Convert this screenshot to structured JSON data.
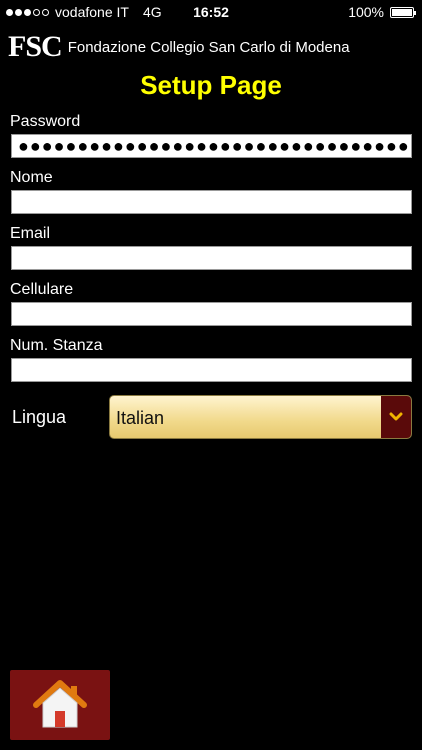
{
  "status_bar": {
    "carrier": "vodafone IT",
    "network": "4G",
    "time": "16:52",
    "battery_percent": "100%"
  },
  "header": {
    "logo": "FSC",
    "org_name": "Fondazione Collegio San Carlo di Modena",
    "title": "Setup Page"
  },
  "form": {
    "password": {
      "label": "Password",
      "value_masked": "●●●●●●●●●●●●●●●●●●●●●●●●●●●●●●●●●●●●"
    },
    "nome": {
      "label": "Nome",
      "value": ""
    },
    "email": {
      "label": "Email",
      "value": ""
    },
    "cellulare": {
      "label": "Cellulare",
      "value": ""
    },
    "stanza": {
      "label": "Num. Stanza",
      "value": ""
    },
    "lingua": {
      "label": "Lingua",
      "selected": "Italian"
    }
  },
  "icons": {
    "home": "home-icon",
    "dropdown": "chevron-down-icon"
  },
  "colors": {
    "title": "#ffff00",
    "home_button": "#7a1212",
    "select_arrow_bg": "#5a0a0a",
    "chevron": "#f0b400"
  }
}
